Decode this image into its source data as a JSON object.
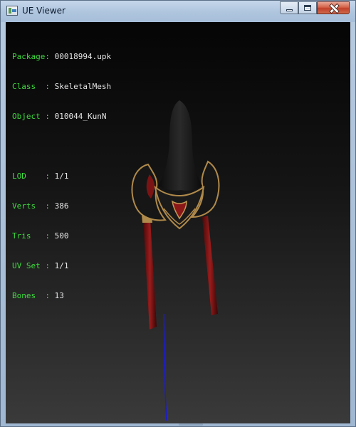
{
  "window": {
    "title": "UE Viewer",
    "icon": "ue-viewer-app-icon"
  },
  "caption_buttons": {
    "minimize": "minimize-icon",
    "maximize": "maximize-icon",
    "close": "close-icon"
  },
  "info": {
    "package": {
      "label": "Package",
      "sep": ": ",
      "value": "00018994.upk"
    },
    "class": {
      "label": "Class  ",
      "sep": ": ",
      "value": "SkeletalMesh"
    },
    "object": {
      "label": "Object ",
      "sep": ": ",
      "value": "010044_KunN"
    },
    "lod": {
      "label": "LOD    ",
      "sep": ": ",
      "value": "1/1"
    },
    "verts": {
      "label": "Verts  ",
      "sep": ": ",
      "value": "386"
    },
    "tris": {
      "label": "Tris   ",
      "sep": ": ",
      "value": "500"
    },
    "uvset": {
      "label": "UV Set ",
      "sep": ": ",
      "value": "1/1"
    },
    "bones": {
      "label": "Bones  ",
      "sep": ": ",
      "value": "13"
    }
  },
  "colors": {
    "label_text": "#3edc3e",
    "value_text": "#e6e6e6",
    "axis_line": "#1a1ad8",
    "mesh_dark": "#151515",
    "mesh_gold": "#b08a4a",
    "mesh_red": "#8a1818"
  }
}
